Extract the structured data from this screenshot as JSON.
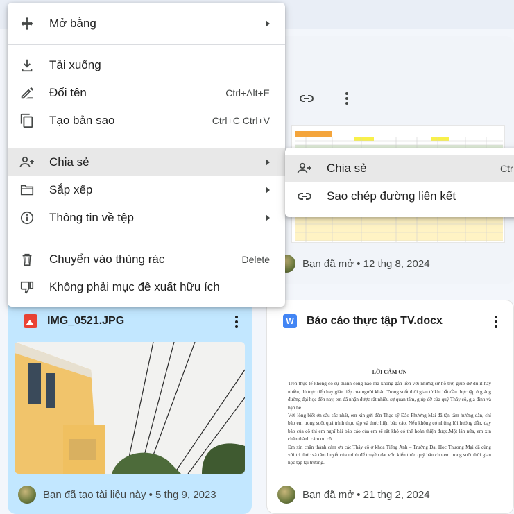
{
  "menu": {
    "items": [
      {
        "label": "Mở bằng",
        "icon": "open-with-icon",
        "has_submenu": true
      },
      {
        "label": "Tải xuống",
        "icon": "download-icon"
      },
      {
        "label": "Đổi tên",
        "icon": "rename-icon",
        "shortcut": "Ctrl+Alt+E"
      },
      {
        "label": "Tạo bản sao",
        "icon": "copy-icon",
        "shortcut": "Ctrl+C Ctrl+V"
      },
      {
        "label": "Chia sẻ",
        "icon": "share-person-icon",
        "has_submenu": true,
        "highlighted": true
      },
      {
        "label": "Sắp xếp",
        "icon": "folder-icon",
        "has_submenu": true
      },
      {
        "label": "Thông tin về tệp",
        "icon": "info-icon",
        "has_submenu": true
      },
      {
        "label": "Chuyển vào thùng rác",
        "icon": "trash-icon",
        "shortcut": "Delete"
      },
      {
        "label": "Không phải mục đề xuất hữu ích",
        "icon": "thumb-down-icon"
      }
    ]
  },
  "submenu": {
    "items": [
      {
        "label": "Chia sẻ",
        "icon": "share-person-icon",
        "shortcut": "Ctr",
        "highlighted": true
      },
      {
        "label": "Sao chép đường liên kết",
        "icon": "link-icon"
      }
    ]
  },
  "cards": {
    "top_right": {
      "owner_text": "Bạn đã mở • 12 thg 8, 2024"
    },
    "bottom_left": {
      "title": "IMG_0521.JPG",
      "owner_text": "Bạn đã tạo tài liệu này • 5 thg 9, 2023"
    },
    "bottom_right": {
      "title": "Báo cáo thực tập TV.docx",
      "file_icon_letter": "W",
      "owner_text": "Bạn đã mở • 21 thg 2, 2024",
      "doc_heading": "LỜI CẢM ƠN",
      "doc_lines": [
        "Trên thực tế không có sự thành công nào mà không gắn liền với những sự hỗ trợ, giúp đỡ dù ít hay nhiều, dù trực tiếp hay gián tiếp của người khác. Trong suốt thời gian từ khi bắt đầu thực tập ở giảng đường đại học đến nay, em đã nhận được rất nhiều sự quan tâm, giúp đỡ của quý Thầy cô, gia đình và bạn bè.",
        "Với lòng biết ơn sâu sắc nhất, em xin gửi đến Thạc sỹ Đào Phương Mai đã tận tâm hướng dẫn, chỉ bảo em trong suốt quá trình thực tập và thực hiện báo cáo. Nếu không có những lời hướng dẫn, dạy bảo của cô thì em nghĩ bài báo cáo của em sẽ rất khó có thể hoàn thiện được.Một lần nữa, em xin chân thành cảm ơn cô.",
        "Em xin chân thành cảm ơn các Thầy cô ở khoa Tiếng Anh – Trường Đại Học Thương Mại đã cùng với tri thức và tâm huyết của mình để truyền đạt vốn kiến thức quý báu cho em trong suốt thời gian học tập tại trường."
      ]
    }
  },
  "colors": {
    "selected_card": "#c2e7ff",
    "menu_hover": "#e8e8e8",
    "doc_icon": "#4285f4",
    "image_icon": "#ea4335"
  }
}
